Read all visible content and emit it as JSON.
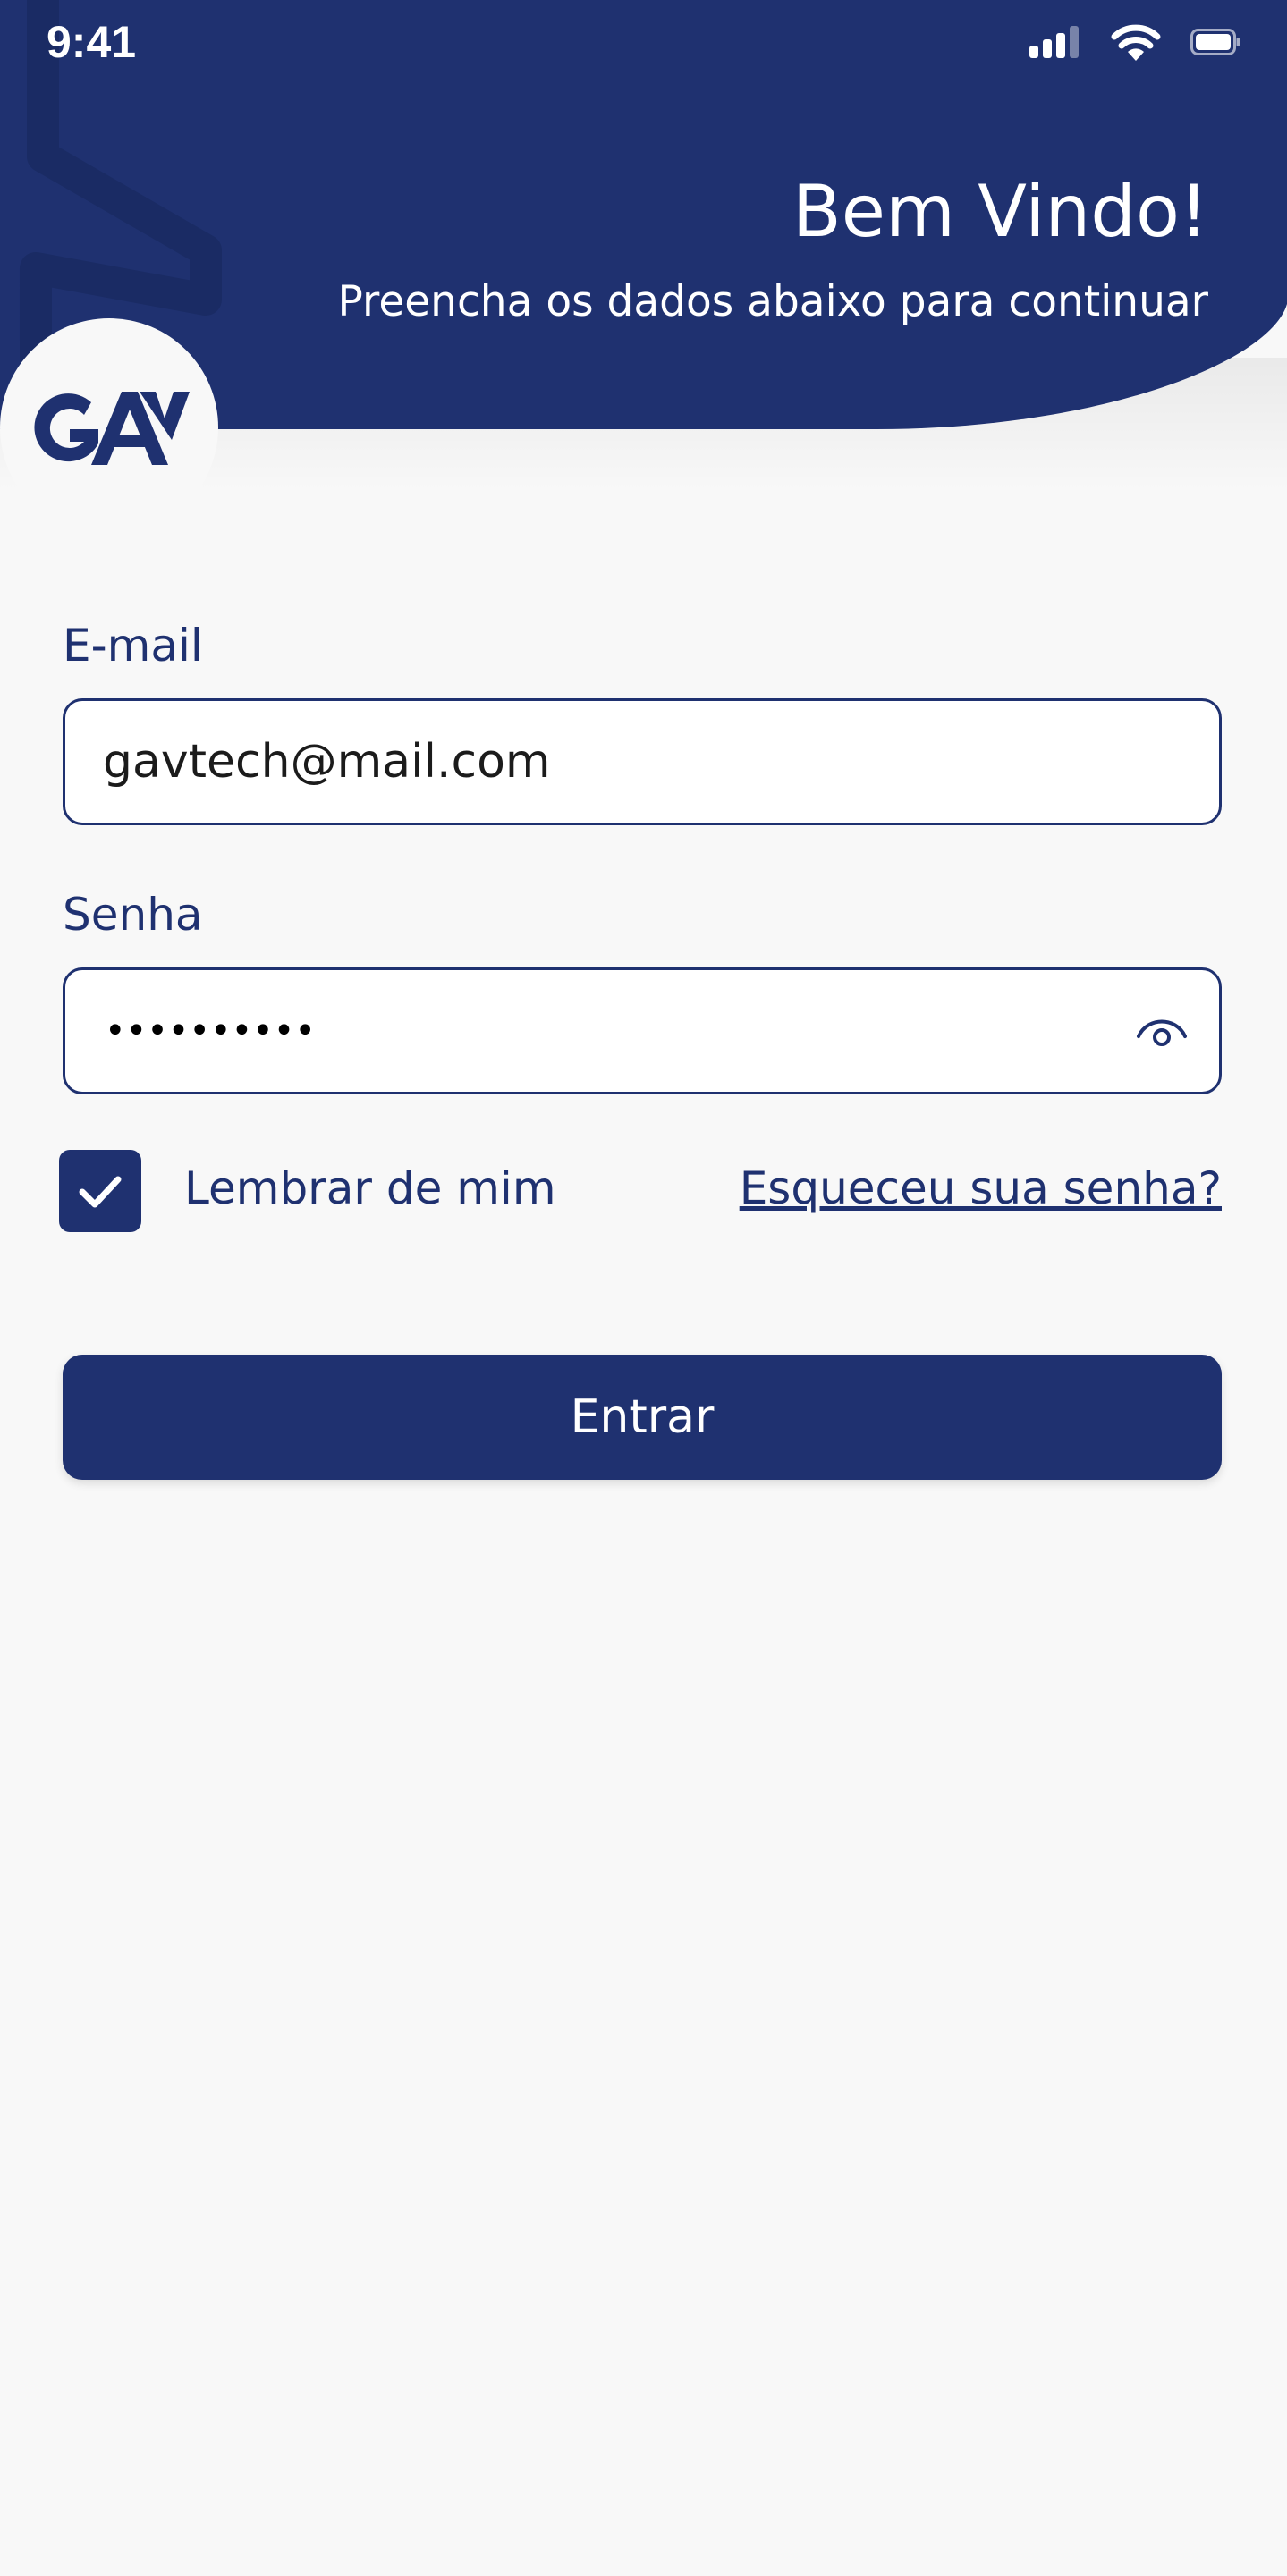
{
  "status_bar": {
    "time": "9:41",
    "icons": [
      "signal-icon",
      "wifi-icon",
      "battery-icon"
    ]
  },
  "header": {
    "title": "Bem Vindo!",
    "subtitle": "Preencha os dados abaixo para continuar",
    "logo_text": "GAV",
    "background_color": "#1f3170"
  },
  "form": {
    "email": {
      "label": "E-mail",
      "value": "gavtech@mail.com"
    },
    "password": {
      "label": "Senha",
      "masked_value": "••••••••••",
      "toggle_icon": "eye-icon"
    },
    "remember": {
      "label": "Lembrar de mim",
      "checked": true,
      "icon": "checkmark-icon"
    },
    "forgot_link": "Esqueceu sua senha?",
    "submit_label": "Entrar"
  },
  "colors": {
    "primary": "#1f3170",
    "background": "#f8f8f8",
    "surface": "#ffffff"
  }
}
